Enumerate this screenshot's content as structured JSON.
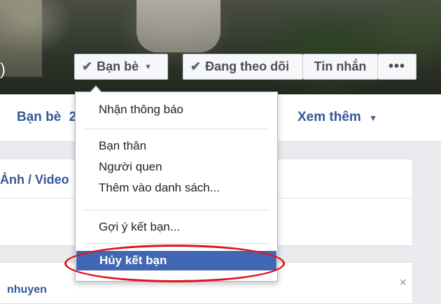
{
  "cover": {
    "paren": ")"
  },
  "actions": {
    "friends_label": "Bạn bè",
    "following_label": "Đang theo dõi",
    "message_label": "Tin nhắn",
    "more_label": "•••"
  },
  "nav": {
    "friends_label": "Bạn bè",
    "friends_suffix": "2",
    "more_label": "Xem thêm"
  },
  "panels": {
    "photos_link": "Ảnh / Video",
    "bottom_partial": "nhuyen",
    "close": "×"
  },
  "menu": {
    "items": [
      {
        "label": "Nhận thông báo"
      },
      {
        "label": "Bạn thân"
      },
      {
        "label": "Người quen"
      },
      {
        "label": "Thêm vào danh sách..."
      },
      {
        "label": "Gợi ý kết bạn..."
      },
      {
        "label": "Hủy kết bạn",
        "highlighted": true
      }
    ]
  },
  "colors": {
    "link": "#365899",
    "menu_highlight": "#4267b2",
    "annotation": "#e0141e"
  },
  "icons": {
    "check": "check-icon",
    "caret": "caret-down-icon"
  }
}
